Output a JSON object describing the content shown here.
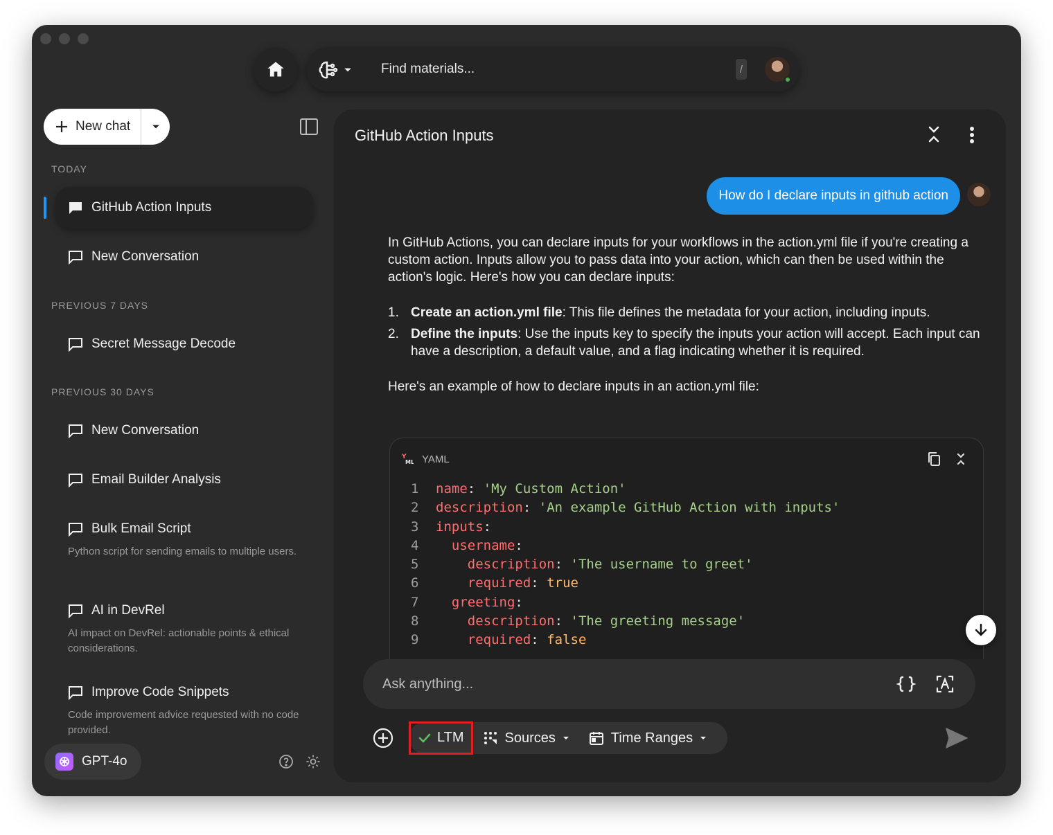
{
  "topbar": {
    "search_placeholder": "Find materials...",
    "shortcut_key": "/"
  },
  "sidebar": {
    "new_chat_label": "New chat",
    "sections": {
      "today": "TODAY",
      "prev7": "PREVIOUS 7 DAYS",
      "prev30": "PREVIOUS 30 DAYS"
    },
    "items": [
      {
        "title": "GitHub Action Inputs",
        "desc": ""
      },
      {
        "title": "New Conversation",
        "desc": ""
      },
      {
        "title": "Secret Message Decode",
        "desc": ""
      },
      {
        "title": "New Conversation",
        "desc": ""
      },
      {
        "title": "Email Builder Analysis",
        "desc": ""
      },
      {
        "title": "Bulk Email Script",
        "desc": "Python script for sending emails to multiple users."
      },
      {
        "title": "AI in DevRel",
        "desc": "AI impact on DevRel: actionable points & ethical considerations."
      },
      {
        "title": "Improve Code Snippets",
        "desc": "Code improvement advice requested with no code provided."
      }
    ],
    "model": "GPT-4o"
  },
  "chat": {
    "title": "GitHub Action Inputs",
    "user_message": "How do I declare inputs in github action",
    "intro": "In GitHub Actions, you can declare inputs for your workflows in the action.yml file if you're creating a custom action. Inputs allow you to pass data into your action, which can then be used within the action's logic. Here's how you can declare inputs:",
    "steps": [
      {
        "num": "1.",
        "bold": "Create an action.yml file",
        "rest": ": This file defines the metadata for your action, including inputs."
      },
      {
        "num": "2.",
        "bold": "Define the inputs",
        "rest": ": Use the inputs key to specify the inputs your action will accept. Each input can have a description, a default value, and a flag indicating whether it is required."
      }
    ],
    "example_intro": "Here's an example of how to declare inputs in an action.yml file:",
    "code": {
      "language": "YAML",
      "lines": [
        {
          "n": "1",
          "indent": "",
          "key": "name",
          "val": "'My Custom Action'",
          "type": "s"
        },
        {
          "n": "2",
          "indent": "",
          "key": "description",
          "val": "'An example GitHub Action with inputs'",
          "type": "s"
        },
        {
          "n": "3",
          "indent": "",
          "key": "inputs",
          "val": "",
          "type": "s"
        },
        {
          "n": "4",
          "indent": "  ",
          "key": "username",
          "val": "",
          "type": "s"
        },
        {
          "n": "5",
          "indent": "    ",
          "key": "description",
          "val": "'The username to greet'",
          "type": "s"
        },
        {
          "n": "6",
          "indent": "    ",
          "key": "required",
          "val": "true",
          "type": "v"
        },
        {
          "n": "7",
          "indent": "  ",
          "key": "greeting",
          "val": "",
          "type": "s"
        },
        {
          "n": "8",
          "indent": "    ",
          "key": "description",
          "val": "'The greeting message'",
          "type": "s"
        },
        {
          "n": "9",
          "indent": "    ",
          "key": "required",
          "val": "false",
          "type": "v"
        }
      ]
    }
  },
  "composer": {
    "placeholder": "Ask anything...",
    "ltm_label": "LTM",
    "sources_label": "Sources",
    "time_ranges_label": "Time Ranges"
  },
  "colors": {
    "accent": "#1e8fe6",
    "highlight_box": "#e02020",
    "yaml_key": "#ff6e6e",
    "yaml_string": "#a6d189",
    "yaml_bool": "#ffb86c"
  }
}
